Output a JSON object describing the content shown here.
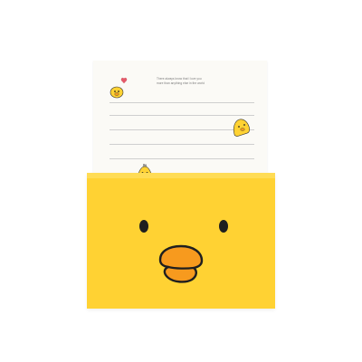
{
  "scene": {
    "subject": "",
    "paper": {
      "message_line1": "There always know that I love you",
      "message_line2": "more than anything else in the world"
    },
    "icons": [
      "heart-icon",
      "chick-icon",
      "duck-face-icon"
    ],
    "colors": {
      "card_yellow": "#ffd233",
      "beak_orange": "#f79a1e",
      "ink": "#1f1f1f",
      "paper": "#fbfaf6",
      "heart": "#e65a6a"
    }
  }
}
